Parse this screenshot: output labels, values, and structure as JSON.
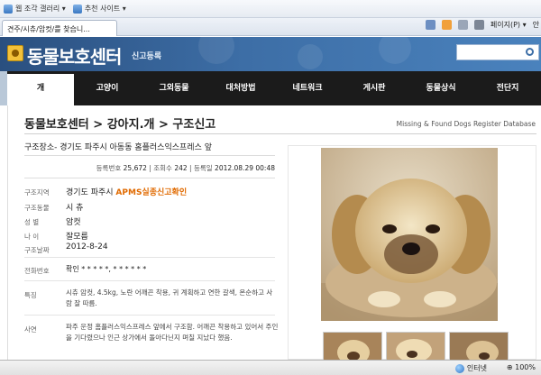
{
  "browser": {
    "favorites": [
      {
        "label": "웹 조각 갤러리 ▾"
      },
      {
        "label": "추천 사이트 ▾"
      }
    ],
    "tab_title": "견주/시츄/암컷/를 찾습니...",
    "cmd_page": "페이지(P) ▾",
    "cmd_safety": "안",
    "status_zone": "인터넷",
    "status_zoom": "⊕ 100%"
  },
  "site": {
    "logo": "동물보호센터",
    "subtitle": "신고등록"
  },
  "nav": {
    "items": [
      "개",
      "고양이",
      "그외동물",
      "대처방법",
      "네트워크",
      "게시판",
      "동물상식",
      "전단지"
    ]
  },
  "page": {
    "breadcrumb": "동물보호센터 > 강아지.개 > 구조신고",
    "breadcrumb_en": "Missing & Found Dogs Register Database",
    "location_title": "구조장소- 경기도 파주시 아동동 홈플러스익스프레스 앞",
    "meta": {
      "reg_label": "등록번호",
      "reg_value": "25,672",
      "views_label": "조회수",
      "views_value": "242",
      "date_label": "등록일",
      "date_value": "2012.08.29 00:48"
    },
    "fields": {
      "area_label": "구조지역",
      "area_value": "경기도 파주시",
      "area_tag": "APMS실종신고확인",
      "breed_label": "구조동물",
      "breed_value": "시 츄",
      "sex_label": "성 별",
      "sex_value": "암컷",
      "age_label": "나 이",
      "age_value": "잘모름",
      "date_label": "구조날짜",
      "date_value": "2012-8-24",
      "phone_label": "전화번호",
      "phone_value": "확인 * * * * *, * * * * * *",
      "feature_label": "특징",
      "feature_value": "시츄 암컷, 4.5kg, 노란 어깨끈 착용, 귀 계획하고 연한 갈색, 온순하고 사람 잘 따름.",
      "story_label": "사연",
      "story_value": "파주 운정 홈플러스익스프레스 앞에서 구조함. 어깨끈 착용하고 있어서 주인을 기다렸으나 인근 상가에서 돌아다닌지 며칠 지났다 했음."
    }
  }
}
